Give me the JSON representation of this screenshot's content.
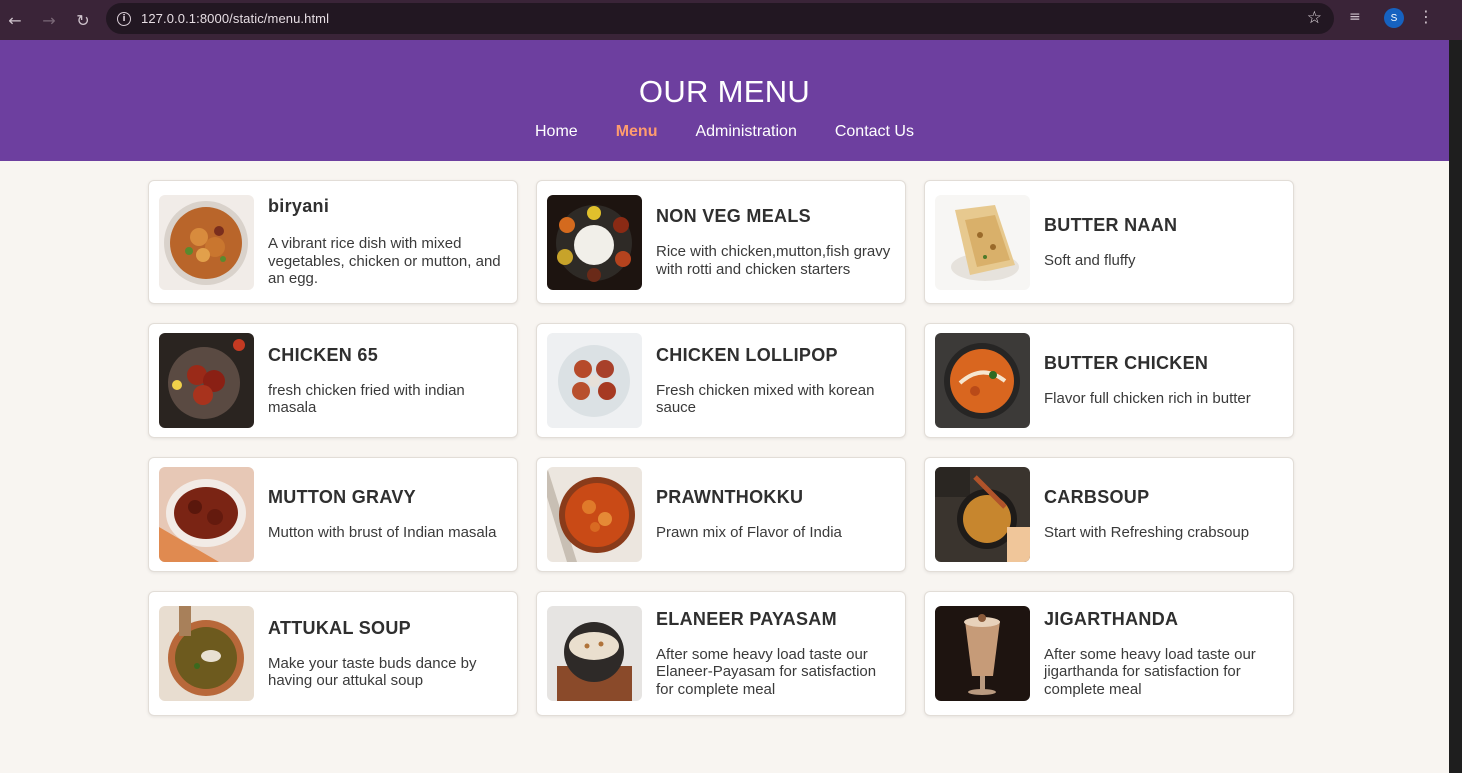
{
  "browser": {
    "url": "127.0.0.1:8000/static/menu.html",
    "back_icon": "arrow-left",
    "forward_icon": "arrow-right",
    "reload_icon": "reload",
    "info_icon": "info-circle",
    "bookmark_icon": "star-outline",
    "profile_initial": "S"
  },
  "header": {
    "title": "OUR MENU",
    "nav": [
      {
        "label": "Home",
        "active": false
      },
      {
        "label": "Menu",
        "active": true
      },
      {
        "label": "Administration",
        "active": false
      },
      {
        "label": "Contact Us",
        "active": false
      }
    ],
    "bg_color": "#6d3f9f",
    "active_color": "#ff9c6e"
  },
  "menu_items": [
    {
      "title": "biryani",
      "desc": "A vibrant rice dish with mixed vegetables, chicken or mutton, and an egg."
    },
    {
      "title": "NON VEG MEALS",
      "desc": "Rice with chicken,mutton,fish gravy with rotti and chicken starters"
    },
    {
      "title": "BUTTER NAAN",
      "desc": "Soft and fluffy"
    },
    {
      "title": "CHICKEN 65",
      "desc": "fresh chicken fried with indian masala"
    },
    {
      "title": "CHICKEN LOLLIPOP",
      "desc": "Fresh chicken mixed with korean sauce"
    },
    {
      "title": "BUTTER CHICKEN",
      "desc": "Flavor full chicken rich in butter"
    },
    {
      "title": "MUTTON GRAVY",
      "desc": "Mutton with brust of Indian masala"
    },
    {
      "title": "PRAWNTHOKKU",
      "desc": "Prawn mix of Flavor of India"
    },
    {
      "title": "CARBSOUP",
      "desc": "Start with Refreshing crabsoup"
    },
    {
      "title": "ATTUKAL SOUP",
      "desc": "Make your taste buds dance by having our attukal soup"
    },
    {
      "title": "ELANEER PAYASAM",
      "desc": "After some heavy load taste our Elaneer-Payasam for satisfaction for complete meal"
    },
    {
      "title": "JIGARTHANDA",
      "desc": "After some heavy load taste our jigarthanda for satisfaction for complete meal"
    }
  ]
}
